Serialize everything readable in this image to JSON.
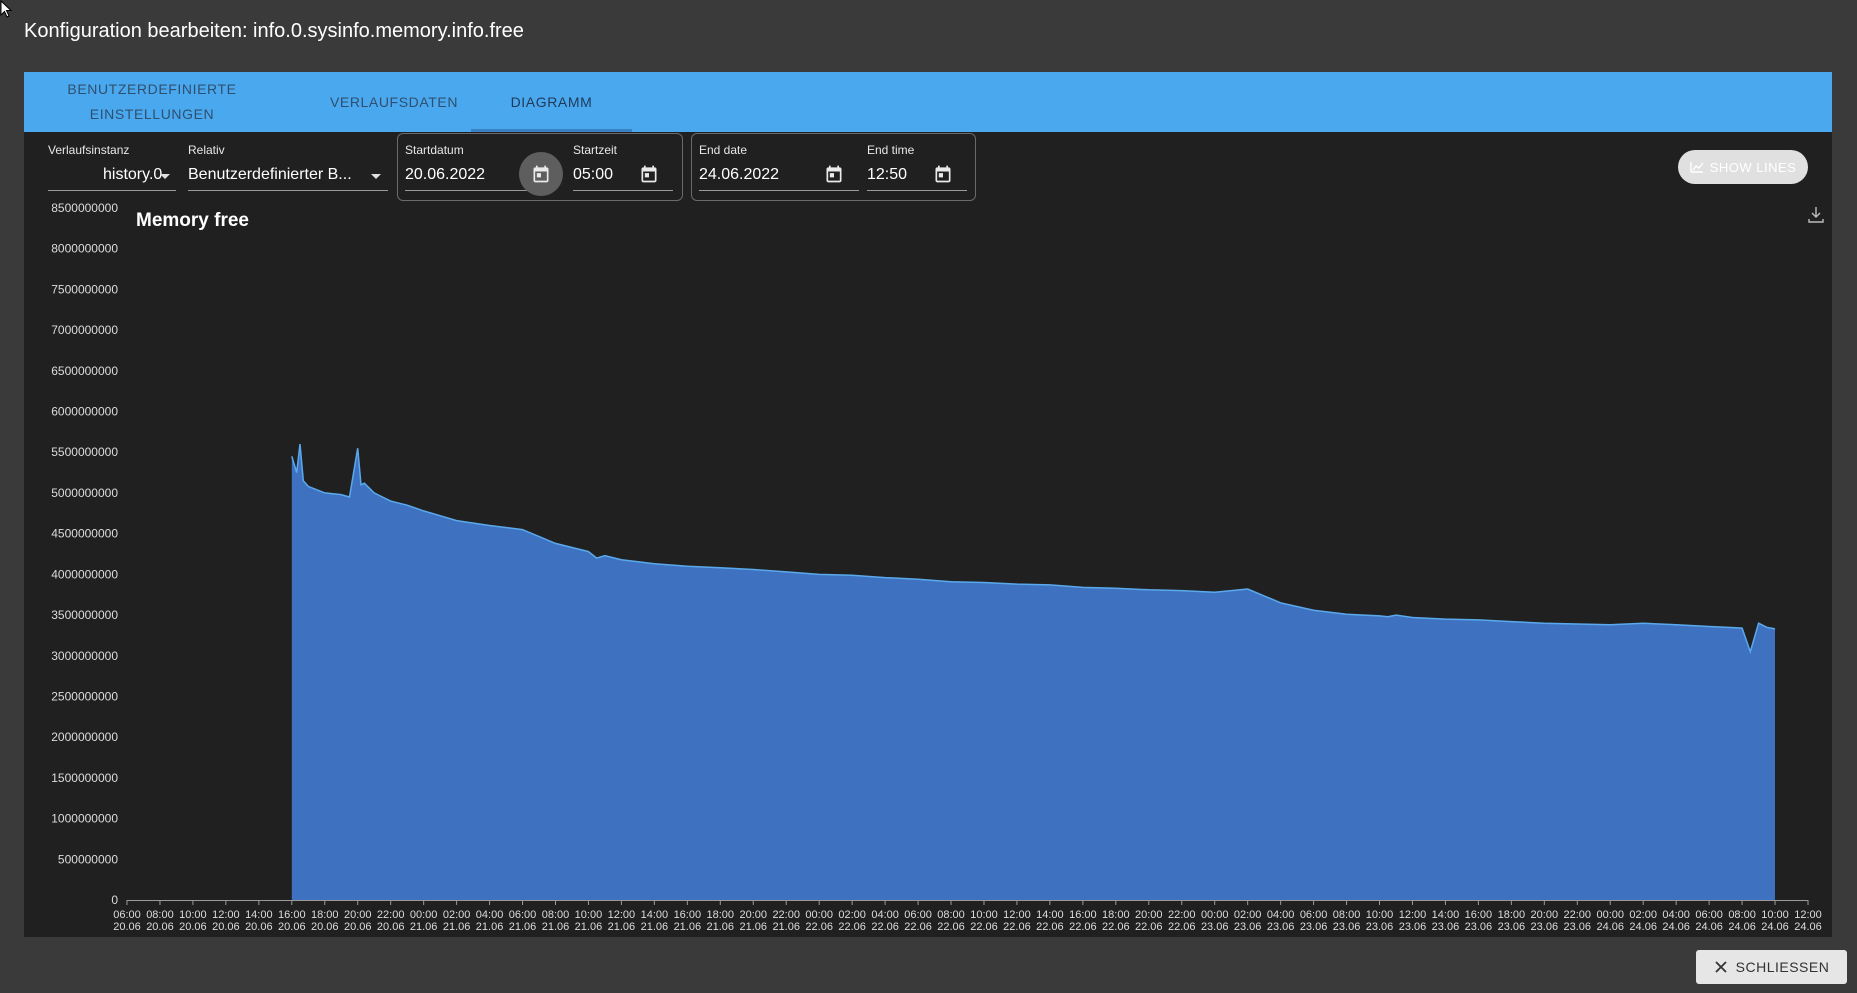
{
  "dialog": {
    "title": "Konfiguration bearbeiten: info.0.sysinfo.memory.info.free"
  },
  "tabs": [
    {
      "label_line1": "BENUTZERDEFINIERTE",
      "label_line2": "EINSTELLUNGEN"
    },
    {
      "label": "VERLAUFSDATEN"
    },
    {
      "label": "DIAGRAMM",
      "active": true
    }
  ],
  "filters": {
    "instance": {
      "label": "Verlaufsinstanz",
      "value": "history.0"
    },
    "relative": {
      "label": "Relativ",
      "value": "Benutzerdefinierter B..."
    },
    "start_date": {
      "label": "Startdatum",
      "value": "20.06.2022"
    },
    "start_time": {
      "label": "Startzeit",
      "value": "05:00"
    },
    "end_date": {
      "label": "End date",
      "value": "24.06.2022"
    },
    "end_time": {
      "label": "End time",
      "value": "12:50"
    }
  },
  "buttons": {
    "show_lines": "SHOW LINES",
    "close": "SCHLIESSEN"
  },
  "colors": {
    "tabbar": "#4aa8ef",
    "area_fill": "#3e72c0",
    "area_line": "#5aa9ec",
    "panel": "#202020"
  },
  "chart_data": {
    "type": "area",
    "title": "Memory free",
    "ylim": [
      0,
      8500000000
    ],
    "yticks": [
      "0",
      "500000000",
      "1000000000",
      "1500000000",
      "2000000000",
      "2500000000",
      "3000000000",
      "3500000000",
      "4000000000",
      "4500000000",
      "5000000000",
      "5500000000",
      "6000000000",
      "6500000000",
      "7000000000",
      "7500000000",
      "8000000000",
      "8500000000"
    ],
    "xticks": [
      [
        "06:00",
        "20.06"
      ],
      [
        "08:00",
        "20.06"
      ],
      [
        "10:00",
        "20.06"
      ],
      [
        "12:00",
        "20.06"
      ],
      [
        "14:00",
        "20.06"
      ],
      [
        "16:00",
        "20.06"
      ],
      [
        "18:00",
        "20.06"
      ],
      [
        "20:00",
        "20.06"
      ],
      [
        "22:00",
        "20.06"
      ],
      [
        "00:00",
        "21.06"
      ],
      [
        "02:00",
        "21.06"
      ],
      [
        "04:00",
        "21.06"
      ],
      [
        "06:00",
        "21.06"
      ],
      [
        "08:00",
        "21.06"
      ],
      [
        "10:00",
        "21.06"
      ],
      [
        "12:00",
        "21.06"
      ],
      [
        "14:00",
        "21.06"
      ],
      [
        "16:00",
        "21.06"
      ],
      [
        "18:00",
        "21.06"
      ],
      [
        "20:00",
        "21.06"
      ],
      [
        "22:00",
        "21.06"
      ],
      [
        "00:00",
        "22.06"
      ],
      [
        "02:00",
        "22.06"
      ],
      [
        "04:00",
        "22.06"
      ],
      [
        "06:00",
        "22.06"
      ],
      [
        "08:00",
        "22.06"
      ],
      [
        "10:00",
        "22.06"
      ],
      [
        "12:00",
        "22.06"
      ],
      [
        "14:00",
        "22.06"
      ],
      [
        "16:00",
        "22.06"
      ],
      [
        "18:00",
        "22.06"
      ],
      [
        "20:00",
        "22.06"
      ],
      [
        "22:00",
        "22.06"
      ],
      [
        "00:00",
        "23.06"
      ],
      [
        "02:00",
        "23.06"
      ],
      [
        "04:00",
        "23.06"
      ],
      [
        "06:00",
        "23.06"
      ],
      [
        "08:00",
        "23.06"
      ],
      [
        "10:00",
        "23.06"
      ],
      [
        "12:00",
        "23.06"
      ],
      [
        "14:00",
        "23.06"
      ],
      [
        "16:00",
        "23.06"
      ],
      [
        "18:00",
        "23.06"
      ],
      [
        "20:00",
        "23.06"
      ],
      [
        "22:00",
        "23.06"
      ],
      [
        "00:00",
        "24.06"
      ],
      [
        "02:00",
        "24.06"
      ],
      [
        "04:00",
        "24.06"
      ],
      [
        "06:00",
        "24.06"
      ],
      [
        "08:00",
        "24.06"
      ],
      [
        "10:00",
        "24.06"
      ],
      [
        "12:00",
        "24.06"
      ]
    ],
    "x_range_hours": [
      0,
      102
    ],
    "series": [
      {
        "x_hours": [
          10.0,
          10.3,
          10.5,
          10.7,
          11.0,
          12.0,
          13.0,
          13.5,
          14.0,
          14.2,
          14.4,
          15.0,
          16.0,
          17.0,
          18.0,
          19.0,
          20.0,
          22.0,
          24.0,
          26.0,
          28.0,
          28.5,
          29.0,
          30.0,
          32.0,
          34.0,
          36.0,
          38.0,
          40.0,
          42.0,
          44.0,
          46.0,
          48.0,
          50.0,
          52.0,
          54.0,
          56.0,
          58.0,
          60.0,
          62.0,
          64.0,
          66.0,
          68.0,
          70.0,
          72.0,
          74.0,
          76.0,
          76.5,
          77.0,
          78.0,
          80.0,
          82.0,
          84.0,
          86.0,
          88.0,
          90.0,
          92.0,
          94.0,
          96.0,
          97.0,
          98.0,
          98.5,
          99.0,
          99.5,
          100.0
        ],
        "values": [
          5450000000,
          5250000000,
          5600000000,
          5150000000,
          5080000000,
          5000000000,
          4980000000,
          4950000000,
          5550000000,
          5100000000,
          5120000000,
          5000000000,
          4900000000,
          4850000000,
          4780000000,
          4720000000,
          4660000000,
          4600000000,
          4550000000,
          4380000000,
          4280000000,
          4200000000,
          4230000000,
          4180000000,
          4130000000,
          4100000000,
          4080000000,
          4060000000,
          4030000000,
          4000000000,
          3990000000,
          3960000000,
          3940000000,
          3910000000,
          3900000000,
          3880000000,
          3870000000,
          3840000000,
          3830000000,
          3810000000,
          3800000000,
          3780000000,
          3820000000,
          3650000000,
          3560000000,
          3510000000,
          3490000000,
          3480000000,
          3500000000,
          3470000000,
          3450000000,
          3440000000,
          3420000000,
          3400000000,
          3390000000,
          3380000000,
          3400000000,
          3380000000,
          3360000000,
          3350000000,
          3340000000,
          3050000000,
          3400000000,
          3350000000,
          3330000000
        ]
      }
    ]
  }
}
